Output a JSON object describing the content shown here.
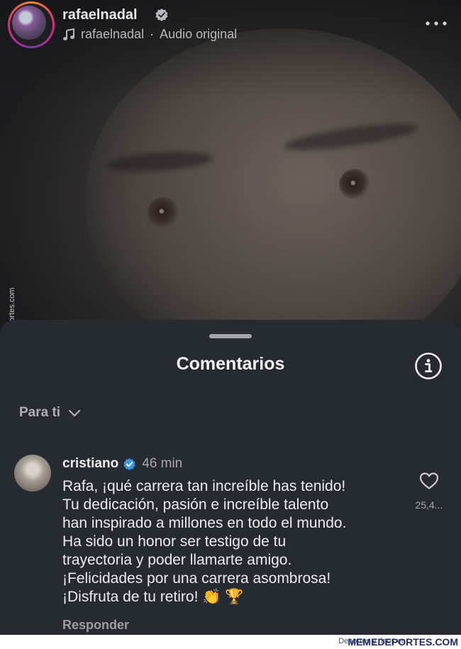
{
  "post": {
    "username": "rafaelnadal",
    "audio_owner": "rafaelnadal",
    "audio_label": "Audio original"
  },
  "watermark": {
    "side_text": "Memedeportes.com",
    "bottom_text": "Deportes y risos en",
    "bottom_brand": "MEMEDEPORTES.COM"
  },
  "comments_sheet": {
    "title": "Comentarios",
    "filter_label": "Para ti",
    "comments": [
      {
        "username": "cristiano",
        "time": "46 min",
        "lines": [
          "Rafa, ¡qué carrera tan increíble has tenido!",
          "Tu dedicación, pasión e increíble talento",
          "han inspirado a millones en todo el mundo.",
          "Ha sido un honor ser testigo de tu",
          "trayectoria y poder llamarte amigo.",
          "¡Felicidades por una carrera asombrosa!",
          "¡Disfruta de tu retiro! 👏 🏆"
        ],
        "reply_label": "Responder",
        "likes": "25,4..."
      }
    ]
  },
  "colors": {
    "sheet_bg": "#262a31",
    "verified_blue": "#3897f0",
    "text_primary": "#f2f2f4",
    "text_secondary": "#a6a8ae"
  }
}
